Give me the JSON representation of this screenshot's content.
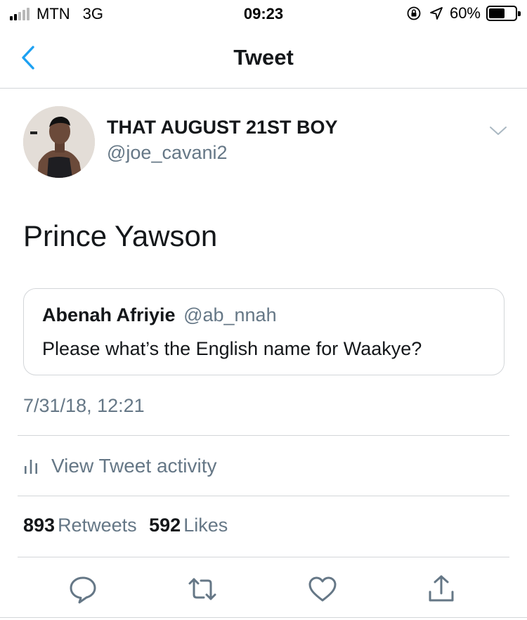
{
  "status_bar": {
    "carrier": "MTN",
    "network": "3G",
    "time": "09:23",
    "battery": "60%",
    "battery_level": 0.6,
    "icons": [
      "signal-icon",
      "rotation-lock-icon",
      "location-icon",
      "battery-icon"
    ]
  },
  "nav": {
    "title": "Tweet",
    "back_icon": "chevron-left-icon"
  },
  "tweet": {
    "display_name": "THAT AUGUST 21ST BOY",
    "handle": "@joe_cavani2",
    "text": "Prince Yawson",
    "timestamp": "7/31/18, 12:21"
  },
  "quoted_tweet": {
    "display_name": "Abenah Afriyie",
    "handle": "@ab_nnah",
    "text": "Please what’s the English name for Waakye?"
  },
  "activity": {
    "label": "View Tweet activity",
    "icon": "bar-chart-icon"
  },
  "stats": {
    "retweets_count": "893",
    "retweets_label": "Retweets",
    "likes_count": "592",
    "likes_label": "Likes"
  },
  "actions": [
    "reply-icon",
    "retweet-icon",
    "like-icon",
    "share-icon"
  ],
  "colors": {
    "accent": "#1da1f2",
    "text_primary": "#14171a",
    "text_secondary": "#657786",
    "divider": "#d3d6d9"
  }
}
